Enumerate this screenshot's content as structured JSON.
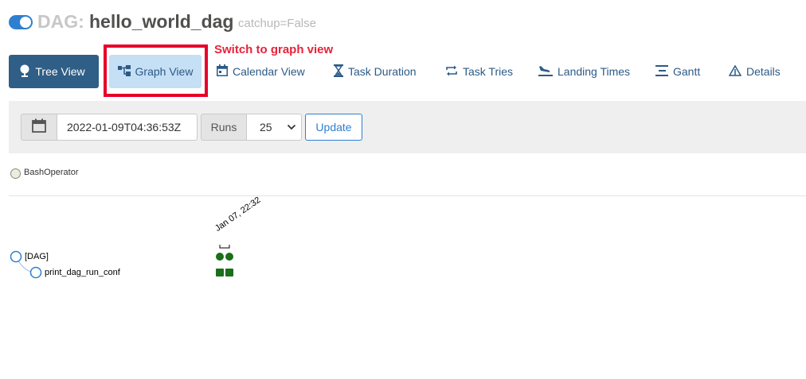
{
  "header": {
    "dag_prefix": "DAG:",
    "dag_name": "hello_world_dag",
    "catchup": "catchup=False",
    "toggle_on": true
  },
  "tabs": [
    {
      "label": "Tree View",
      "icon": "tree-icon",
      "active": true
    },
    {
      "label": "Graph View",
      "icon": "graph-icon",
      "highlighted": true
    },
    {
      "label": "Calendar View",
      "icon": "calendar-icon"
    },
    {
      "label": "Task Duration",
      "icon": "hourglass-icon"
    },
    {
      "label": "Task Tries",
      "icon": "retry-icon"
    },
    {
      "label": "Landing Times",
      "icon": "plane-landing-icon"
    },
    {
      "label": "Gantt",
      "icon": "gantt-icon"
    },
    {
      "label": "Details",
      "icon": "warning-triangle-icon"
    }
  ],
  "annotation": {
    "text": "Switch to graph view",
    "color": "#e8223b"
  },
  "form": {
    "base_date": "2022-01-09T04:36:53Z",
    "runs_label": "Runs",
    "runs_value": "25",
    "update_label": "Update"
  },
  "legend": {
    "operator": "BashOperator",
    "operator_color": "#ededdd"
  },
  "tree": {
    "root_label": "[DAG]",
    "task_label": "print_dag_run_conf",
    "run_date": "Jan 07, 22:32",
    "run_state": "success",
    "success_color": "#1b6e1b"
  },
  "colors": {
    "accent": "#2f7fd1",
    "active_tab": "#2f5e86",
    "highlight_tab": "#c5dff4"
  }
}
